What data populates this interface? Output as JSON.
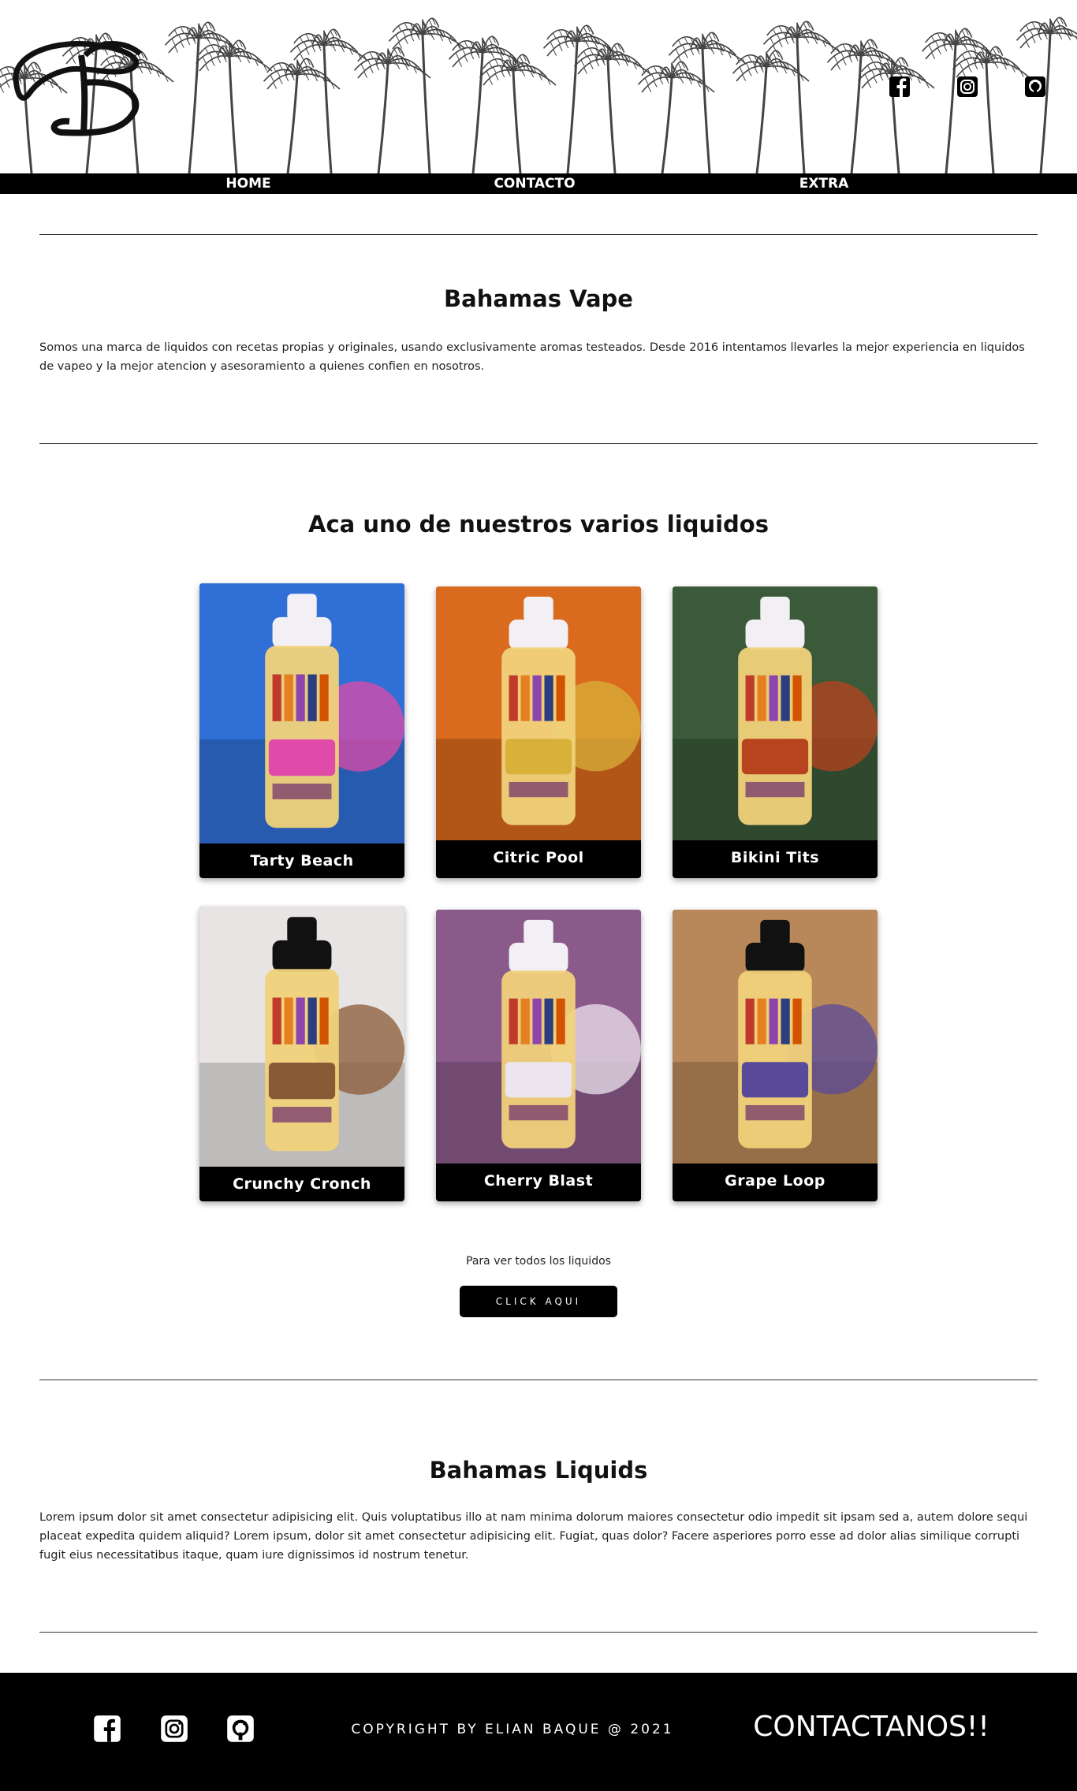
{
  "header": {
    "logo_name": "bahamas-logo",
    "social": [
      {
        "name": "facebook-icon"
      },
      {
        "name": "instagram-icon"
      },
      {
        "name": "github-icon"
      }
    ]
  },
  "nav": {
    "items": [
      {
        "label": "HOME"
      },
      {
        "label": "CONTACTO"
      },
      {
        "label": "EXTRA"
      }
    ]
  },
  "about": {
    "title": "Bahamas Vape",
    "text": "Somos una marca de liquidos con recetas propias y originales, usando exclusivamente aromas testeados. Desde 2016 intentamos llevarles la mejor experiencia en liquidos de vapeo y la mejor atencion y asesoramiento a quienes confien en nosotros."
  },
  "products": {
    "title": "Aca uno de nuestros varios liquidos",
    "items": [
      {
        "name": "Tarty Beach",
        "bg": "#2f6fd6",
        "accent": "#e04aa8"
      },
      {
        "name": "Citric Pool",
        "bg": "#d96a1e",
        "accent": "#d8b03a"
      },
      {
        "name": "Bikini Tits",
        "bg": "#3a5a3a",
        "accent": "#b8431f"
      },
      {
        "name": "Crunchy Cronch",
        "bg": "#e8e4e4",
        "accent": "#8a5a36"
      },
      {
        "name": "Cherry Blast",
        "bg": "#8a5a8a",
        "accent": "#ece4ee"
      },
      {
        "name": "Grape Loop",
        "bg": "#b8885a",
        "accent": "#5a4a9a"
      }
    ],
    "cta_text": "Para ver todos los liquidos",
    "cta_button": "CLICK AQUI"
  },
  "liquids": {
    "title": "Bahamas Liquids",
    "text": "Lorem ipsum dolor sit amet consectetur adipisicing elit. Quis voluptatibus illo at nam minima dolorum maiores consectetur odio impedit sit ipsam sed a, autem dolore sequi placeat expedita quidem aliquid? Lorem ipsum, dolor sit amet consectetur adipisicing elit. Fugiat, quas dolor? Facere asperiores porro esse ad dolor alias similique corrupti fugit eius necessitatibus itaque, quam iure dignissimos id nostrum tenetur."
  },
  "footer": {
    "copyright": "COPYRIGHT BY ELIAN BAQUE @ 2021",
    "contact": "CONTACTANOS!!"
  },
  "colors": {
    "brand_black": "#000000",
    "background": "#ffffff"
  }
}
